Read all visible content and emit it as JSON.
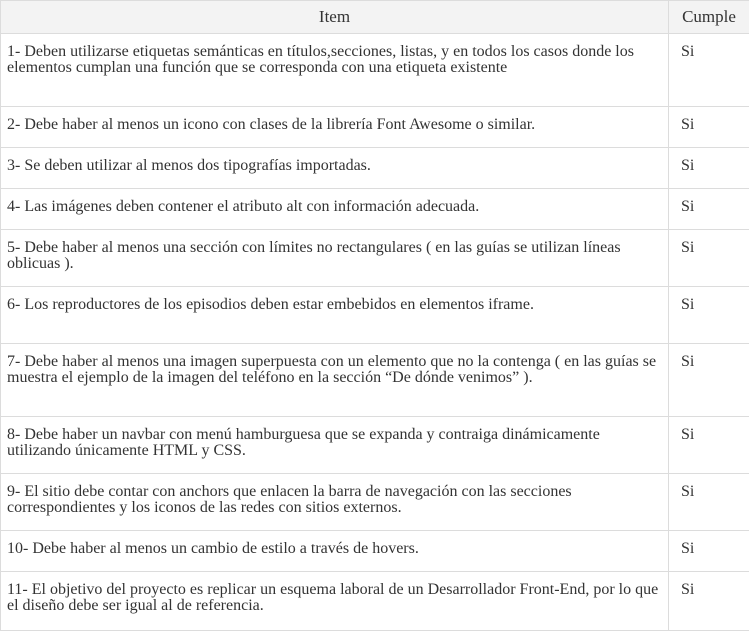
{
  "table": {
    "headers": {
      "item": "Item",
      "cumple": "Cumple"
    },
    "rows": [
      {
        "item": "1- Deben utilizarse etiquetas semánticas en títulos,secciones, listas, y en todos los casos donde los elementos cumplan una función que se corresponda con una etiqueta existente",
        "cumple": "Si"
      },
      {
        "item": "2- Debe haber al menos un icono con clases de la librería Font Awesome o similar.",
        "cumple": "Si"
      },
      {
        "item": "3- Se deben utilizar al menos dos tipografías importadas.",
        "cumple": "Si"
      },
      {
        "item": "4- Las imágenes deben contener el atributo alt con información adecuada.",
        "cumple": "Si"
      },
      {
        "item": "5- Debe haber al menos una sección con límites no rectangulares ( en las guías se utilizan líneas oblicuas ).",
        "cumple": "Si"
      },
      {
        "item": "6- Los reproductores de los episodios deben estar embebidos en elementos iframe.",
        "cumple": "Si"
      },
      {
        "item": "7- Debe haber al menos una imagen superpuesta con un elemento que no la contenga ( en las guías se muestra el ejemplo de la imagen del teléfono en la sección “De dónde venimos” ).",
        "cumple": "Si"
      },
      {
        "item": "8- Debe haber un navbar con menú hamburguesa que se expanda y contraiga dinámicamente utilizando únicamente HTML y CSS.",
        "cumple": "Si"
      },
      {
        "item": "9- El sitio debe contar con anchors que enlacen la barra de navegación con las secciones correspondientes y los iconos de las redes con sitios externos.",
        "cumple": "Si"
      },
      {
        "item": "10- Debe haber al menos un cambio de estilo a través de hovers.",
        "cumple": "Si"
      },
      {
        "item": "11- El objetivo del proyecto es replicar un esquema laboral de un Desarrollador Front-End, por lo que el diseño debe ser igual al de referencia.",
        "cumple": "Si"
      }
    ]
  }
}
